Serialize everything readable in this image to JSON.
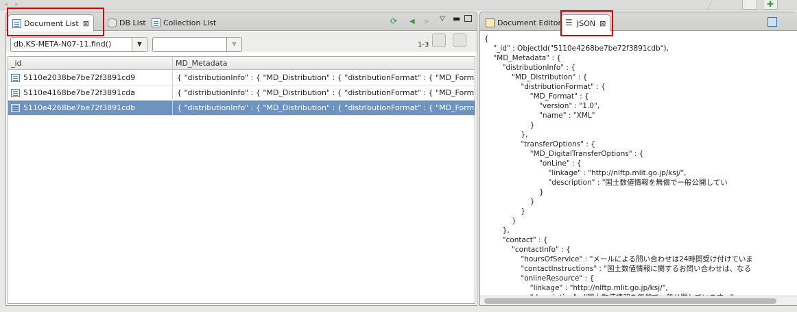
{
  "left_panel": {
    "tabs": [
      {
        "label": "Document List"
      },
      {
        "label": "DB List"
      },
      {
        "label": "Collection List"
      }
    ],
    "query_combo": {
      "value": "db.KS-META-N07-11.find()"
    },
    "filter_combo": {
      "value": ""
    },
    "page_range": "1-3",
    "columns": [
      "_id",
      "MD_Metadata"
    ],
    "rows": [
      {
        "id": "5110e2038be7be72f3891cd9",
        "md": "{ \"distributionInfo\" : { \"MD_Distribution\" : { \"distributionFormat\" : { \"MD_Format\" : {"
      },
      {
        "id": "5110e4168be7be72f3891cda",
        "md": "{ \"distributionInfo\" : { \"MD_Distribution\" : { \"distributionFormat\" : { \"MD_Format\" : {"
      },
      {
        "id": "5110e4268be7be72f3891cdb",
        "md": "{ \"distributionInfo\" : { \"MD_Distribution\" : { \"distributionFormat\" : { \"MD_Format\" : {"
      }
    ]
  },
  "right_panel": {
    "tabs": [
      {
        "label": "Document Editor"
      },
      {
        "label": "JSON"
      }
    ],
    "json_lines": [
      "{",
      "    \"_id\" : ObjectId(\"5110e4268be7be72f3891cdb\"),",
      "    \"MD_Metadata\" : {",
      "        \"distributionInfo\" : {",
      "            \"MD_Distribution\" : {",
      "                \"distributionFormat\" : {",
      "                    \"MD_Format\" : {",
      "                        \"version\" : \"1.0\",",
      "                        \"name\" : \"XML\"",
      "                    }",
      "                },",
      "                \"transferOptions\" : {",
      "                    \"MD_DigitalTransferOptions\" : {",
      "                        \"onLine\" : {",
      "                            \"linkage\" : \"http://nlftp.mlit.go.jp/ksj/\",",
      "                            \"description\" : \"国土数値情報を無償で一般公開してい",
      "                        }",
      "                    }",
      "                }",
      "            }",
      "        },",
      "        \"contact\" : {",
      "            \"contactInfo\" : {",
      "                \"hoursOfService\" : \"メールによる問い合わせは24時間受け付けていま",
      "                \"contactInstructions\" : \"国土数値情報に関するお問い合わせは、なる",
      "                \"onlineResource\" : {",
      "                    \"linkage\" : \"http://nlftp.mlit.go.jp/ksj/\",",
      "                    \"description\" : \"国土数値情報を無償で一般公開しています。\""
    ]
  },
  "colors": {
    "selection": "#6f93bf",
    "highlight_box": "#e00000"
  },
  "icons": [
    "document-icon",
    "database-icon",
    "collection-icon",
    "json-list-icon",
    "document-editor-icon",
    "refresh-icon",
    "prev-arrow-icon",
    "next-arrow-icon",
    "view-menu-icon",
    "minimize-icon",
    "maximize-icon",
    "close-icon",
    "save-icon"
  ]
}
